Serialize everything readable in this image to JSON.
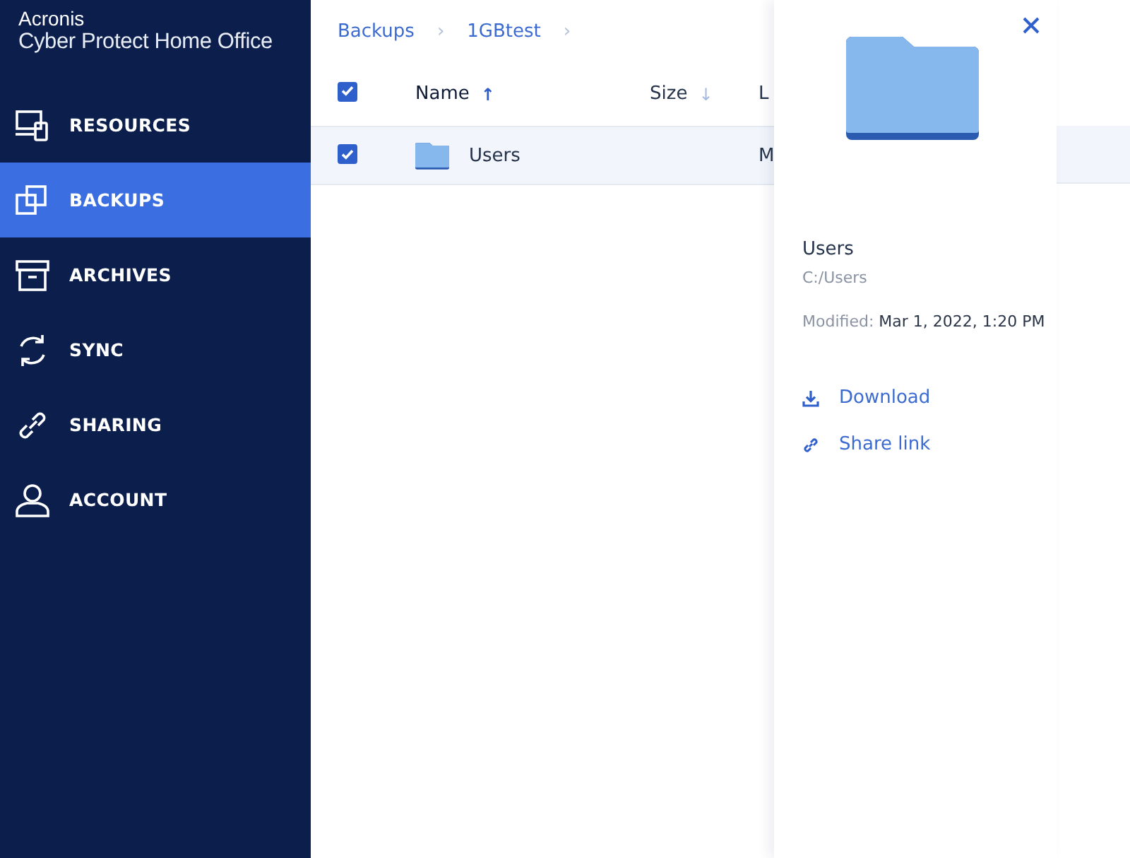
{
  "app": {
    "brand": "Acronis",
    "product": "Cyber Protect Home Office"
  },
  "sidebar": {
    "items": [
      {
        "kind": "resources",
        "label": "RESOURCES",
        "selected": false
      },
      {
        "kind": "backups",
        "label": "BACKUPS",
        "selected": true
      },
      {
        "kind": "archives",
        "label": "ARCHIVES",
        "selected": false
      },
      {
        "kind": "sync",
        "label": "SYNC",
        "selected": false
      },
      {
        "kind": "sharing",
        "label": "SHARING",
        "selected": false
      },
      {
        "kind": "account",
        "label": "ACCOUNT",
        "selected": false
      }
    ]
  },
  "breadcrumb": [
    {
      "label": "Backups",
      "separator": "›"
    },
    {
      "label": "1GBtest",
      "separator": "›"
    }
  ],
  "table": {
    "select_all_checked": true,
    "columns": [
      {
        "label": "Name",
        "sort_icon": "↑",
        "selected": true
      },
      {
        "label": "Size",
        "sort_icon": "↓",
        "selected": false
      },
      {
        "label": "L",
        "selected": false
      }
    ],
    "rows": [
      {
        "name": "Users",
        "column_3": "M",
        "checked": true,
        "selected": true
      }
    ]
  },
  "details": {
    "name": "Users",
    "path": "C:/Users",
    "modified_label": "Modified:",
    "modified": "Mar 1, 2022, 1:20 PM",
    "actions": [
      {
        "kind": "download",
        "label": "Download"
      },
      {
        "kind": "share",
        "label": "Share link"
      }
    ]
  }
}
